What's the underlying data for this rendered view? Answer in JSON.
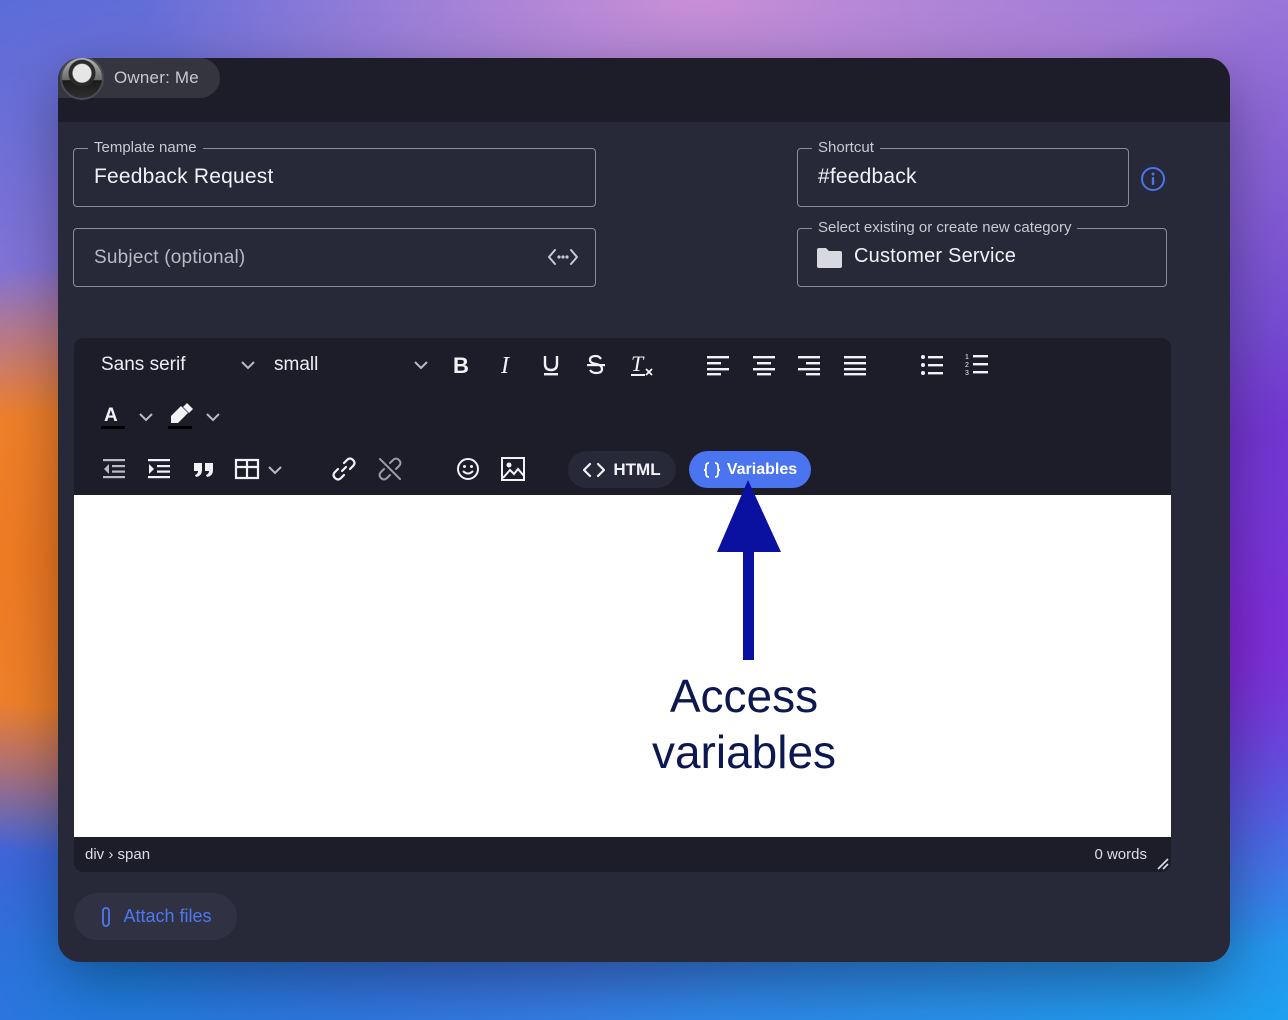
{
  "owner": {
    "label": "Owner: Me"
  },
  "form": {
    "template_name": {
      "legend": "Template name",
      "value": "Feedback Request"
    },
    "subject": {
      "placeholder": "Subject (optional)"
    },
    "shortcut": {
      "legend": "Shortcut",
      "value": "#feedback"
    },
    "category": {
      "legend": "Select existing or create new category",
      "value": "Customer Service"
    }
  },
  "toolbar": {
    "font_family": "Sans serif",
    "font_size": "small",
    "html_label": "HTML",
    "variables_label": "Variables"
  },
  "statusbar": {
    "path": "div › span",
    "word_count": "0 words"
  },
  "attach_label": "Attach files",
  "annotation": {
    "line1": "Access",
    "line2": "variables"
  },
  "colors": {
    "accent": "#4a74f0",
    "panel": "#272838",
    "toolbar": "#1c1d28",
    "annotation": "#0a10a0"
  }
}
